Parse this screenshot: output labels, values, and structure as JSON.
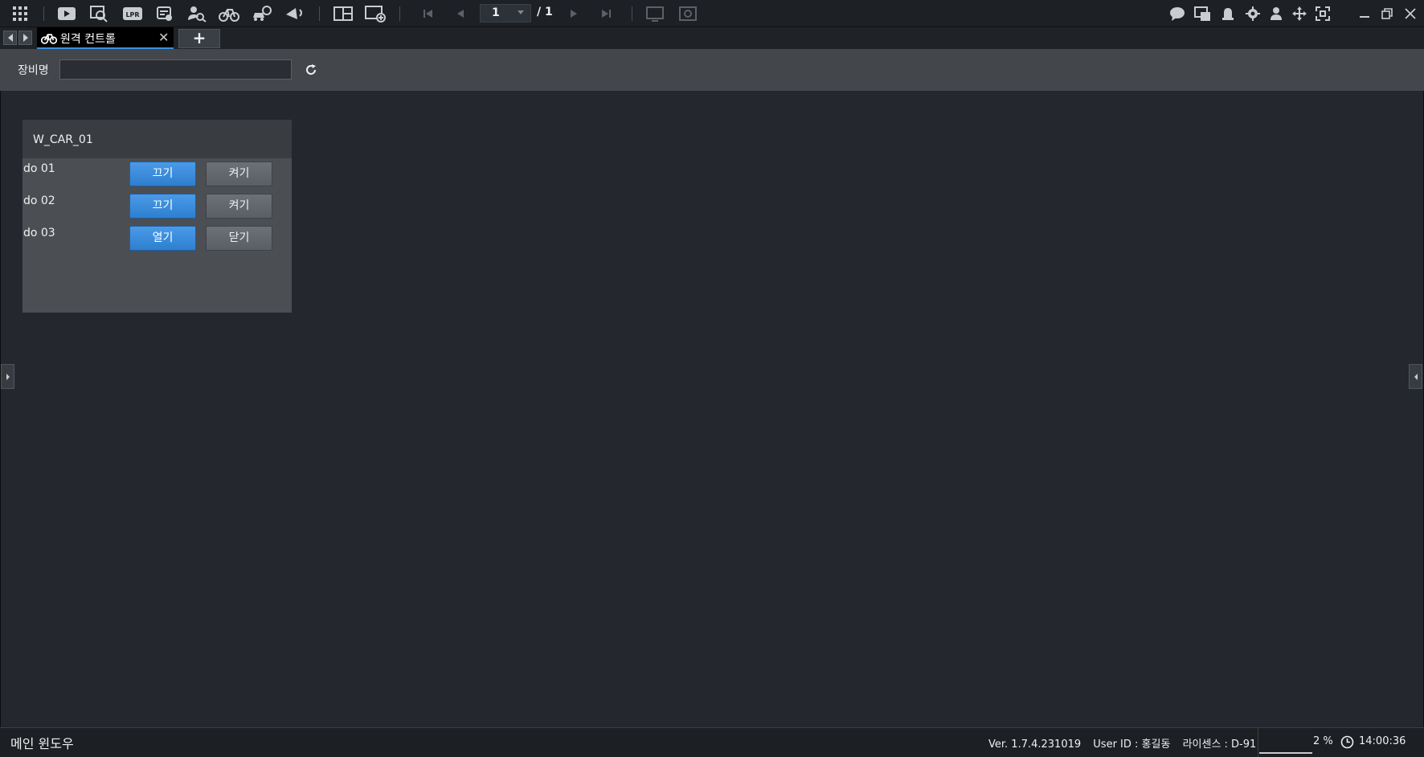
{
  "toolbar": {
    "page_current": "1",
    "page_total": "/ 1",
    "left_icons": [
      "grid-menu-icon",
      "video-play-icon",
      "video-search-icon",
      "lpr-icon",
      "card-list-icon",
      "person-search-icon",
      "bicycle-icon",
      "car-search-icon",
      "broadcast-icon"
    ],
    "layout_icons": [
      "split-layout-icon",
      "add-view-icon"
    ],
    "nav_icons": [
      "first-page-icon",
      "prev-page-icon",
      "next-page-icon",
      "last-page-icon"
    ],
    "right_icons": [
      "chat-icon",
      "video-alert-icon",
      "alarm-icon",
      "settings-icon",
      "user-icon",
      "move-icon",
      "fullscreen-icon",
      "minimize-icon",
      "restore-icon",
      "close-icon"
    ]
  },
  "tabs": [
    {
      "label": "원격 컨트롤",
      "icon": "bicycle-icon",
      "active": true
    }
  ],
  "tab_add_label": "+",
  "filter": {
    "label": "장비명",
    "value": ""
  },
  "device": {
    "name": "W_CAR_01",
    "rows": [
      {
        "label": "do 01",
        "primary": "끄기",
        "secondary": "켜기"
      },
      {
        "label": "do 02",
        "primary": "끄기",
        "secondary": "켜기"
      },
      {
        "label": "do 03",
        "primary": "열기",
        "secondary": "닫기"
      }
    ]
  },
  "status": {
    "title": "메인 윈도우",
    "version": "Ver. 1.7.4.231019",
    "user": "User ID : 홍길동",
    "license": "라이센스 : D-91",
    "cpu": "2 %",
    "time": "14:00:36"
  },
  "colors": {
    "accent_blue": "#3a8fe0",
    "background": "#24282e",
    "toolbar": "#1d2024"
  }
}
